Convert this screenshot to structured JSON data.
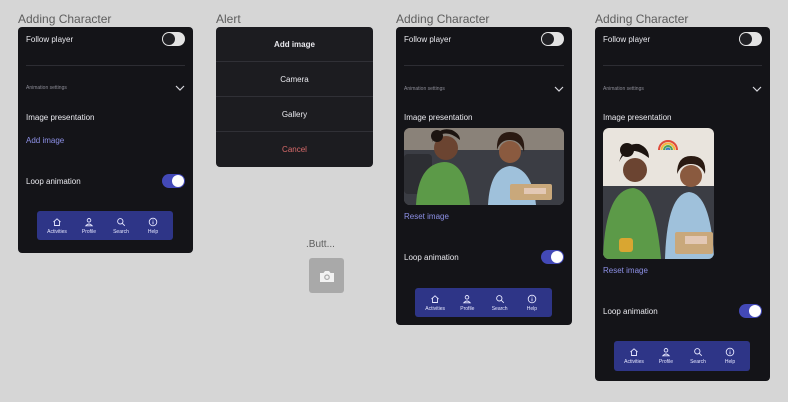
{
  "frames": {
    "frame1_title": "Adding Character",
    "alert_title": "Alert",
    "button_title": ".Butt...",
    "frame3_title": "Adding Character",
    "frame4_title": "Adding Character"
  },
  "screen": {
    "follow_player": "Follow player",
    "animation_settings": "Animation settings",
    "image_presentation": "Image presentation",
    "add_image": "Add image",
    "reset_image": "Reset image",
    "loop_animation": "Loop animation"
  },
  "nav": {
    "activities": "Activities",
    "profile": "Profile",
    "search": "Search",
    "help": "Help"
  },
  "alert": {
    "title": "Add image",
    "camera": "Camera",
    "gallery": "Gallery",
    "cancel": "Cancel"
  },
  "colors": {
    "screen_bg": "#141418",
    "accent": "#4349b7",
    "nav_bg": "#2e3587",
    "link": "#8d90e6",
    "cancel": "#d86a6a"
  },
  "states": {
    "follow_player_on": false,
    "loop_animation_on": true
  }
}
